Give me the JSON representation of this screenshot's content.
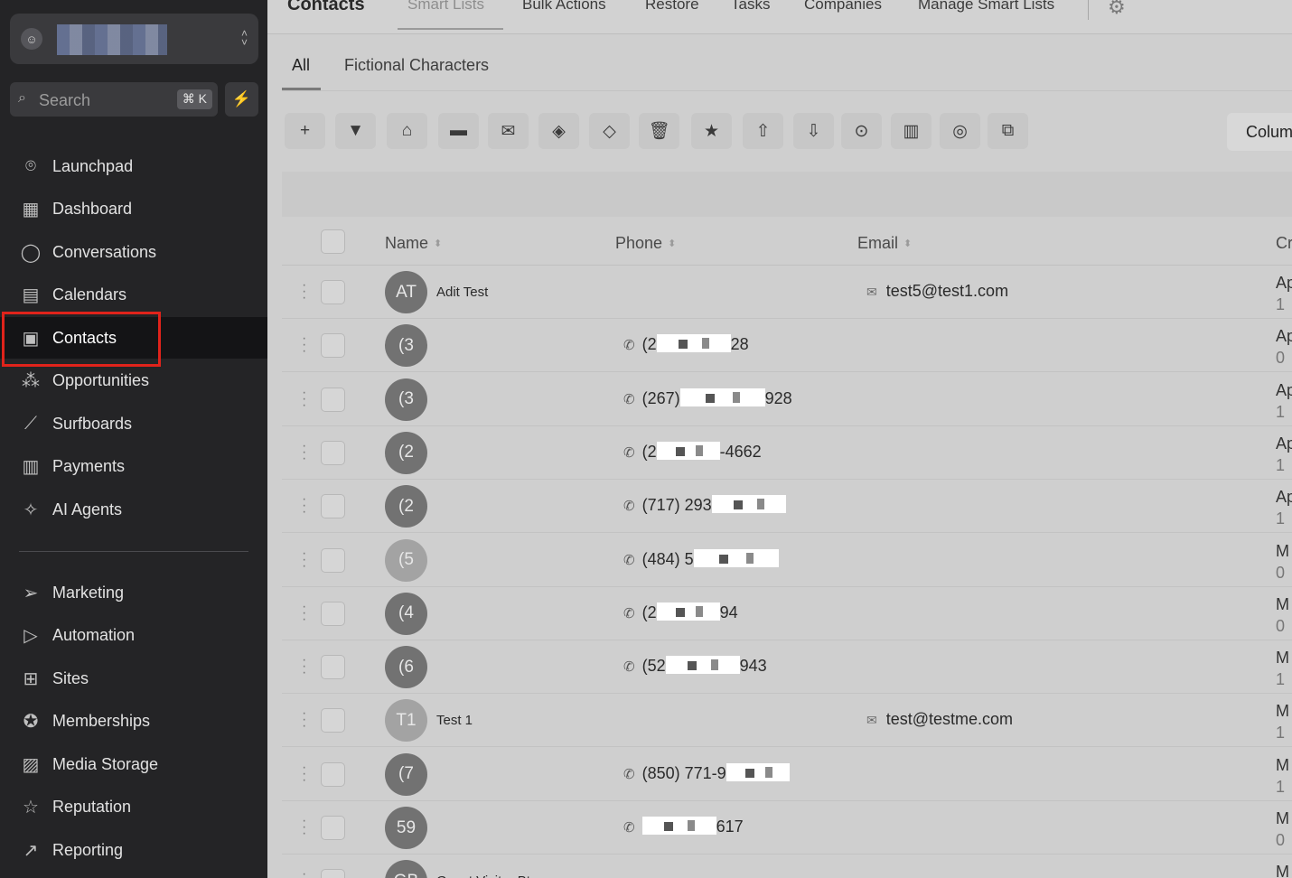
{
  "sidebar": {
    "search": {
      "placeholder": "Search",
      "shortcut": "⌘ K"
    },
    "nav_primary": [
      {
        "label": "Launchpad",
        "icon": "launchpad-icon",
        "glyph": "⌾"
      },
      {
        "label": "Dashboard",
        "icon": "dashboard-icon",
        "glyph": "▦"
      },
      {
        "label": "Conversations",
        "icon": "chat-bubble-icon",
        "glyph": "◯"
      },
      {
        "label": "Calendars",
        "icon": "calendar-icon",
        "glyph": "▤"
      },
      {
        "label": "Contacts",
        "icon": "contacts-icon",
        "glyph": "▣",
        "active": true
      },
      {
        "label": "Opportunities",
        "icon": "opportunities-icon",
        "glyph": "⁂"
      },
      {
        "label": "Surfboards",
        "icon": "surfboard-icon",
        "glyph": "⟋"
      },
      {
        "label": "Payments",
        "icon": "payments-icon",
        "glyph": "▥"
      },
      {
        "label": "AI Agents",
        "icon": "sparkle-icon",
        "glyph": "✧"
      }
    ],
    "nav_secondary": [
      {
        "label": "Marketing",
        "icon": "send-icon",
        "glyph": "➢"
      },
      {
        "label": "Automation",
        "icon": "automation-icon",
        "glyph": "▷"
      },
      {
        "label": "Sites",
        "icon": "sites-icon",
        "glyph": "⊞"
      },
      {
        "label": "Memberships",
        "icon": "memberships-icon",
        "glyph": "✪"
      },
      {
        "label": "Media Storage",
        "icon": "media-icon",
        "glyph": "▨"
      },
      {
        "label": "Reputation",
        "icon": "star-icon",
        "glyph": "☆"
      },
      {
        "label": "Reporting",
        "icon": "trend-icon",
        "glyph": "↗"
      }
    ]
  },
  "header": {
    "title": "Contacts",
    "tabs": [
      "Smart Lists",
      "Bulk Actions",
      "Restore",
      "Tasks",
      "Companies",
      "Manage Smart Lists"
    ]
  },
  "subtabs": [
    "All",
    "Fictional Characters"
  ],
  "toolbar": {
    "buttons": [
      {
        "name": "add-contact-button",
        "glyph": "+"
      },
      {
        "name": "filter-button",
        "glyph": "▼"
      },
      {
        "name": "automation-bot-button",
        "glyph": "⌂"
      },
      {
        "name": "sms-button",
        "glyph": "▬"
      },
      {
        "name": "email-button",
        "glyph": "✉"
      },
      {
        "name": "add-tag-button",
        "glyph": "◈"
      },
      {
        "name": "remove-tag-button",
        "glyph": "◇"
      },
      {
        "name": "delete-button",
        "glyph": "🗑"
      },
      {
        "name": "review-star-button",
        "glyph": "★"
      },
      {
        "name": "export-button",
        "glyph": "⇧"
      },
      {
        "name": "import-button",
        "glyph": "⇩"
      },
      {
        "name": "add-to-campaign-button",
        "glyph": "⊙"
      },
      {
        "name": "company-button",
        "glyph": "▥"
      },
      {
        "name": "whatsapp-button",
        "glyph": "◎"
      },
      {
        "name": "duplicate-button",
        "glyph": "⧉"
      }
    ],
    "columns_label": "Colum"
  },
  "table": {
    "headers": {
      "name": "Name",
      "phone": "Phone",
      "email": "Email",
      "created": "Cr"
    },
    "rows": [
      {
        "initials": "AT",
        "name": "Adit Test",
        "phone_prefix": "",
        "phone_suffix": "",
        "email": "test5@test1.com",
        "created": "Ap",
        "created_sub": "1"
      },
      {
        "initials": "(3",
        "name": "",
        "phone_prefix": "(2",
        "phone_suffix": "28",
        "email": "",
        "created": "Ap",
        "created_sub": "0"
      },
      {
        "initials": "(3",
        "name": "",
        "phone_prefix": "(267)",
        "phone_suffix": "928",
        "email": "",
        "created": "Ap",
        "created_sub": "1"
      },
      {
        "initials": "(2",
        "name": "",
        "phone_prefix": "(2",
        "phone_suffix": "-4662",
        "email": "",
        "created": "Ap",
        "created_sub": "1"
      },
      {
        "initials": "(2",
        "name": "",
        "phone_prefix": "(717) 293",
        "phone_suffix": "",
        "email": "",
        "created": "Ap",
        "created_sub": "1"
      },
      {
        "initials": "(5",
        "name": "",
        "phone_prefix": "(484) 5",
        "phone_suffix": "",
        "email": "",
        "created": "M",
        "created_sub": "0",
        "light": true
      },
      {
        "initials": "(4",
        "name": "",
        "phone_prefix": "(2",
        "phone_suffix": "94",
        "email": "",
        "created": "M",
        "created_sub": "0"
      },
      {
        "initials": "(6",
        "name": "",
        "phone_prefix": "(52",
        "phone_suffix": "943",
        "email": "",
        "created": "M",
        "created_sub": "1"
      },
      {
        "initials": "T1",
        "name": "Test 1",
        "phone_prefix": "",
        "phone_suffix": "",
        "email": "test@testme.com",
        "created": "M",
        "created_sub": "1",
        "light": true
      },
      {
        "initials": "(7",
        "name": "",
        "phone_prefix": "(850) 771-9",
        "phone_suffix": "",
        "email": "",
        "created": "M",
        "created_sub": "1"
      },
      {
        "initials": "59",
        "name": "",
        "phone_prefix": "",
        "phone_suffix": "617",
        "email": "",
        "created": "M",
        "created_sub": "0"
      },
      {
        "initials": "GB",
        "name": "Guest Visitor Btown",
        "phone_prefix": "",
        "phone_suffix": "",
        "email": "",
        "created": "M",
        "created_sub": ""
      }
    ]
  }
}
